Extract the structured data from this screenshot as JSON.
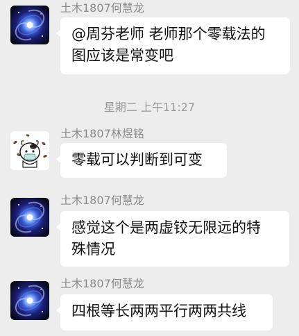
{
  "messages": [
    {
      "sender": "土木1807何慧龙",
      "avatar_icon": "galaxy-avatar-icon",
      "lines": [
        "@周芬老师 老师那个零载法的",
        "图应该是常变吧"
      ]
    },
    {
      "sender": "土木1807林煜铭",
      "avatar_icon": "cartoon-cow-avatar-icon",
      "lines": [
        "零载可以判断到可变"
      ]
    },
    {
      "sender": "土木1807何慧龙",
      "avatar_icon": "galaxy-avatar-icon",
      "lines": [
        "感觉这个是两虚铰无限远的特",
        "殊情况"
      ]
    },
    {
      "sender": "土木1807何慧龙",
      "avatar_icon": "galaxy-avatar-icon",
      "lines": [
        "四根等长两两平行两两共线"
      ]
    }
  ],
  "timestamp": "星期二 上午11:27",
  "colors": {
    "background": "#ededed",
    "bubble": "#ffffff",
    "sender_text": "#8a8a8a",
    "timestamp_text": "#9a9a9a"
  }
}
